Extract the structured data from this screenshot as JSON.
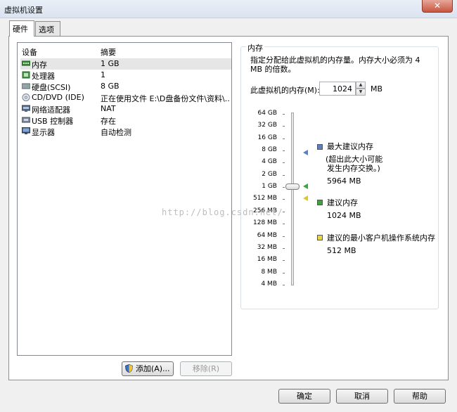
{
  "window": {
    "title": "虚拟机设置",
    "close_glyph": "✕"
  },
  "tabs": [
    {
      "label": "硬件",
      "active": true
    },
    {
      "label": "选项",
      "active": false
    }
  ],
  "device_list": {
    "col_device": "设备",
    "col_summary": "摘要",
    "rows": [
      {
        "name": "内存",
        "summary": "1 GB",
        "icon": "memory-icon",
        "selected": true
      },
      {
        "name": "处理器",
        "summary": "1",
        "icon": "processor-icon"
      },
      {
        "name": "硬盘(SCSI)",
        "summary": "8 GB",
        "icon": "harddisk-icon"
      },
      {
        "name": "CD/DVD (IDE)",
        "summary": "正在使用文件 E:\\D盘备份文件\\资料\\...",
        "icon": "cdrom-icon"
      },
      {
        "name": "网络适配器",
        "summary": "NAT",
        "icon": "network-adapter-icon"
      },
      {
        "name": "USB 控制器",
        "summary": "存在",
        "icon": "usb-icon"
      },
      {
        "name": "显示器",
        "summary": "自动检测",
        "icon": "monitor-icon"
      }
    ]
  },
  "buttons": {
    "add": "添加(A)...",
    "remove": "移除(R)",
    "ok": "确定",
    "cancel": "取消",
    "help": "帮助"
  },
  "memory": {
    "group_title": "内存",
    "description": "指定分配给此虚拟机的内存量。内存大小必须为 4 MB 的倍数。",
    "input_label": "此虚拟机的内存(M):",
    "value": "1024",
    "unit": "MB",
    "scale": [
      "64 GB",
      "32 GB",
      "16 GB",
      "8 GB",
      "4 GB",
      "2 GB",
      "1 GB",
      "512 MB",
      "256 MB",
      "128 MB",
      "64 MB",
      "32 MB",
      "16 MB",
      "8 MB",
      "4 MB"
    ],
    "legend": {
      "max_title": "最大建议内存",
      "max_note_1": "(超出此大小可能",
      "max_note_2": "发生内存交换。)",
      "max_value": "5964 MB",
      "rec_title": "建议内存",
      "rec_value": "1024 MB",
      "min_title": "建议的最小客户机操作系统内存",
      "min_value": "512 MB"
    },
    "colors": {
      "max": "#5b7fc7",
      "recommended": "#3aa53a",
      "minimum": "#e8d840"
    }
  },
  "watermark": "http://blog.csdn.net/"
}
